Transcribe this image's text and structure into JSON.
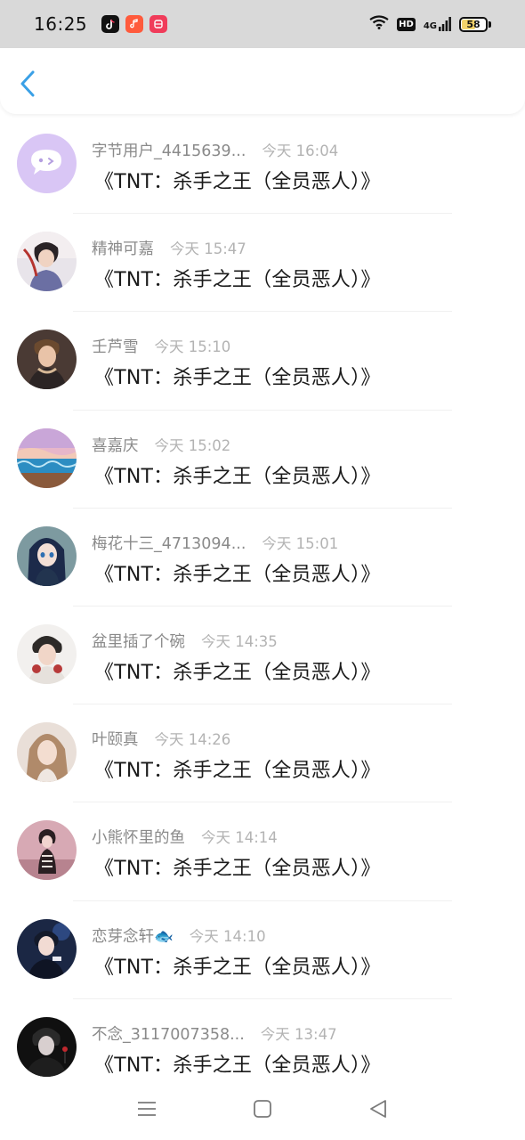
{
  "status_bar": {
    "time": "16:25",
    "apps": [
      "tiktok-icon",
      "music-app-icon",
      "red-app-icon"
    ],
    "network_label": "4G",
    "hd_label": "HD",
    "battery_level": "58",
    "battery_fraction": 0.58,
    "battery_color": "#f2d36b"
  },
  "header": {
    "back_icon": "chevron-left-icon",
    "accent_color": "#3aa0e6"
  },
  "items": [
    {
      "name": "字节用户_4415639...",
      "time": "今天 16:04",
      "title": "《TNT：杀手之王（全员恶人）》",
      "avatar": "default-chat-avatar"
    },
    {
      "name": "精神可嘉",
      "time": "今天 15:47",
      "title": "《TNT：杀手之王（全员恶人）》",
      "avatar": "user-photo-avatar"
    },
    {
      "name": "壬芦雪",
      "time": "今天 15:10",
      "title": "《TNT：杀手之王（全员恶人）》",
      "avatar": "user-photo-avatar"
    },
    {
      "name": "喜嘉庆",
      "time": "今天 15:02",
      "title": "《TNT：杀手之王（全员恶人）》",
      "avatar": "user-photo-avatar"
    },
    {
      "name": "梅花十三_4713094...",
      "time": "今天 15:01",
      "title": "《TNT：杀手之王（全员恶人）》",
      "avatar": "user-photo-avatar"
    },
    {
      "name": "盆里插了个碗",
      "time": "今天 14:35",
      "title": "《TNT：杀手之王（全员恶人）》",
      "avatar": "user-photo-avatar"
    },
    {
      "name": "叶颐真",
      "time": "今天 14:26",
      "title": "《TNT：杀手之王（全员恶人）》",
      "avatar": "user-photo-avatar"
    },
    {
      "name": "小熊怀里的鱼",
      "time": "今天 14:14",
      "title": "《TNT：杀手之王（全员恶人）》",
      "avatar": "user-photo-avatar"
    },
    {
      "name": "恋芽念轩🐟",
      "time": "今天 14:10",
      "title": "《TNT：杀手之王（全员恶人）》",
      "avatar": "user-photo-avatar"
    },
    {
      "name": "不念_3117007358...",
      "time": "今天 13:47",
      "title": "《TNT：杀手之王（全员恶人）》",
      "avatar": "user-photo-avatar"
    }
  ],
  "nav_bar": {
    "menu_icon": "menu-icon",
    "home_icon": "home-square-icon",
    "back_icon": "back-triangle-icon"
  }
}
